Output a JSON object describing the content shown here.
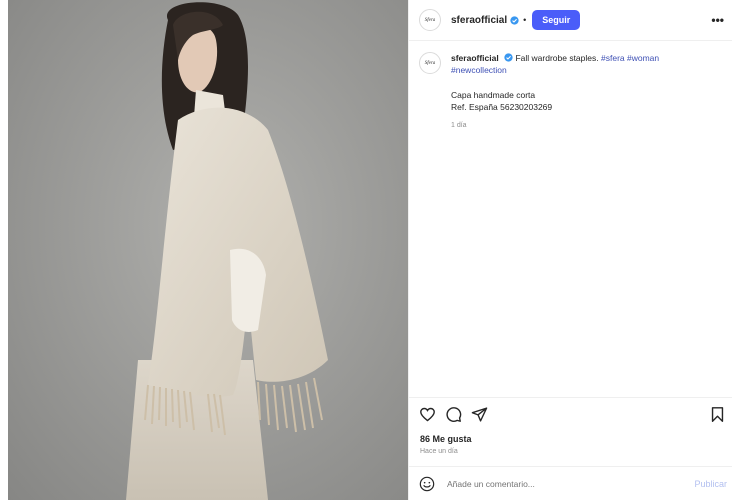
{
  "post": {
    "username": "sferaofficial",
    "avatar_text": "Sfera",
    "follow_label": "Seguir",
    "separator": "•",
    "more_label": "•••",
    "caption": {
      "text": "Fall wardrobe staples.",
      "tags": [
        "#sfera",
        "#woman",
        "#newcollection"
      ],
      "line1": "Capa handmade corta",
      "line2": "Ref. España 56230203269",
      "time": "1 día"
    },
    "likes": "86 Me gusta",
    "time_ago": "Hace un día",
    "comment_placeholder": "Añade un comentario...",
    "publish_label": "Publicar"
  },
  "colors": {
    "accent": "#4a5df9",
    "hashtag": "#3f51b5",
    "verified": "#3897f0",
    "publish_disabled": "#b3c0f0",
    "photo_background": "#9c9c9a"
  },
  "icons": {
    "verified": "verified-badge-icon",
    "like": "heart-icon",
    "comment": "comment-bubble-icon",
    "share": "paper-plane-icon",
    "save": "bookmark-icon",
    "emoji": "emoji-smile-icon",
    "more": "more-options-icon"
  }
}
